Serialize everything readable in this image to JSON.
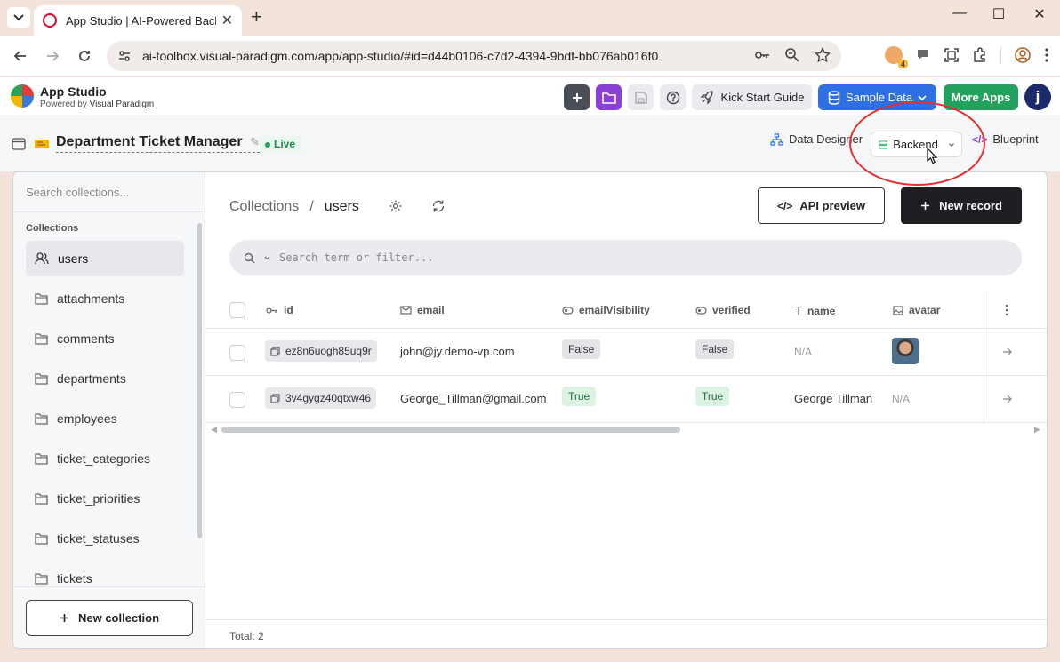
{
  "browser": {
    "tab_title": "App Studio | AI-Powered Backend",
    "url": "ai-toolbox.visual-paradigm.com/app/app-studio/#id=d44b0106-c7d2-4394-9bdf-bb076ab016f0",
    "extension_badge": "4"
  },
  "app_header": {
    "app_name": "App Studio",
    "powered_prefix": "Powered by",
    "powered_link": "Visual Paradigm",
    "kick_start_label": "Kick Start Guide",
    "sample_data_label": "Sample Data",
    "more_apps_label": "More Apps",
    "avatar_letter": "j"
  },
  "project": {
    "title": "Department Ticket Manager",
    "status": "Live"
  },
  "view_tabs": {
    "data_designer": "Data Designer",
    "backend": "Backend",
    "blueprint": "Blueprint"
  },
  "sidebar": {
    "search_placeholder": "Search collections...",
    "heading": "Collections",
    "items": [
      {
        "label": "users",
        "icon": "users-icon",
        "active": true
      },
      {
        "label": "attachments",
        "icon": "folder-icon"
      },
      {
        "label": "comments",
        "icon": "folder-icon"
      },
      {
        "label": "departments",
        "icon": "folder-icon"
      },
      {
        "label": "employees",
        "icon": "folder-icon"
      },
      {
        "label": "ticket_categories",
        "icon": "folder-icon"
      },
      {
        "label": "ticket_priorities",
        "icon": "folder-icon"
      },
      {
        "label": "ticket_statuses",
        "icon": "folder-icon"
      },
      {
        "label": "tickets",
        "icon": "folder-icon"
      }
    ],
    "new_collection_label": "New collection"
  },
  "content": {
    "breadcrumb_root": "Collections",
    "breadcrumb_sep": "/",
    "breadcrumb_current": "users",
    "api_preview_label": "API preview",
    "new_record_label": "New record",
    "search_placeholder": "Search term or filter..."
  },
  "table": {
    "columns": [
      "id",
      "email",
      "emailVisibility",
      "verified",
      "name",
      "avatar"
    ],
    "rows": [
      {
        "id": "ez8n6uogh85uq9r",
        "email": "john@jy.demo-vp.com",
        "emailVisibility": "False",
        "verified": "False",
        "name": "N/A",
        "avatar": "photo"
      },
      {
        "id": "3v4gygz40qtxw46",
        "email": "George_Tillman@gmail.com",
        "emailVisibility": "True",
        "verified": "True",
        "name": "George Tillman",
        "avatar": "N/A"
      }
    ],
    "total_label": "Total: 2"
  },
  "colors": {
    "primary_blue": "#2f6fe4",
    "purple": "#8b3fd9",
    "green": "#23a25d",
    "dark": "#1d1f23",
    "highlight_red": "#e0302f"
  }
}
